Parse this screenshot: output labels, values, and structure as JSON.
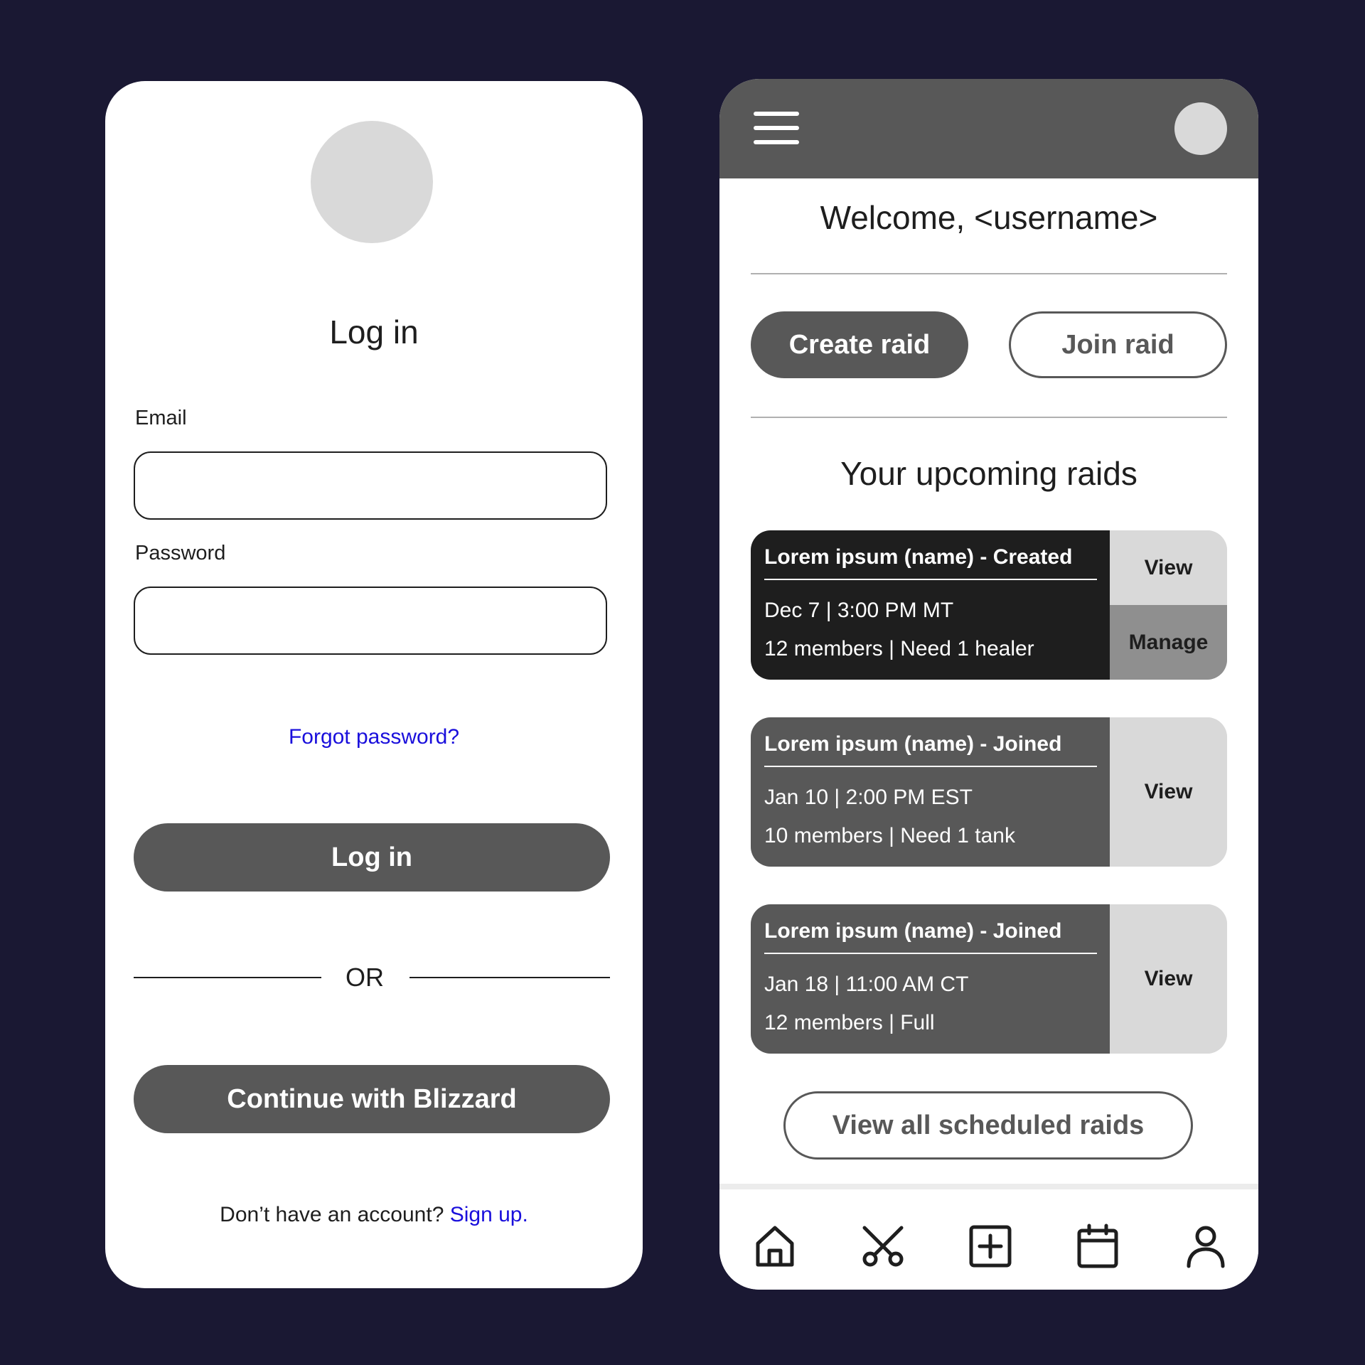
{
  "login": {
    "title": "Log in",
    "email_label": "Email",
    "email_value": "",
    "password_label": "Password",
    "password_value": "",
    "forgot_link": "Forgot password?",
    "login_button": "Log in",
    "or_text": "OR",
    "blizzard_button": "Continue with Blizzard",
    "signup_prompt": "Don’t have an account?",
    "signup_link": "Sign up."
  },
  "dashboard": {
    "welcome": "Welcome, <username>",
    "create_button": "Create raid",
    "join_button": "Join raid",
    "section_title": "Your upcoming raids",
    "raids": [
      {
        "title": "Lorem ipsum (name) - Created",
        "datetime": "Dec 7 | 3:00 PM MT",
        "details": "12 members | Need 1 healer",
        "view_label": "View",
        "manage_label": "Manage"
      },
      {
        "title": "Lorem ipsum (name) - Joined",
        "datetime": "Jan 10 | 2:00 PM EST",
        "details": "10 members | Need 1 tank",
        "view_label": "View"
      },
      {
        "title": "Lorem ipsum (name) - Joined",
        "datetime": "Jan 18 | 11:00 AM CT",
        "details": "12 members | Full",
        "view_label": "View"
      }
    ],
    "view_all_button": "View all scheduled raids",
    "nav_icons": [
      "home-icon",
      "scissors-icon",
      "add-square-icon",
      "calendar-icon",
      "profile-icon"
    ]
  },
  "colors": {
    "background": "#1a1833",
    "panel": "#ffffff",
    "dark_gray": "#585858",
    "black_card": "#1e1e1e",
    "light_gray": "#d9d9d9",
    "manage_gray": "#8f8f8f",
    "link_blue": "#1a0fdc"
  }
}
